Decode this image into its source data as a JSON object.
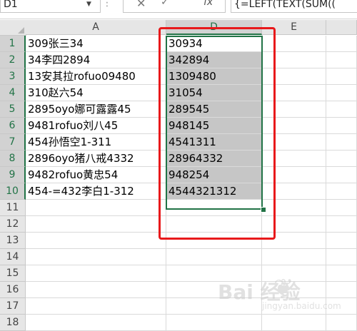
{
  "formula_bar": {
    "name_box": "D1",
    "formula": "{=LEFT(TEXT(SUM(("
  },
  "columns": [
    {
      "label": "A",
      "selected": false
    },
    {
      "label": "D",
      "selected": true
    },
    {
      "label": "E",
      "selected": false
    }
  ],
  "rows": [
    {
      "num": "1",
      "a": "309张三34",
      "d": "30934"
    },
    {
      "num": "2",
      "a": "34李四2894",
      "d": "342894"
    },
    {
      "num": "3",
      "a": "13安其拉rofuo09480",
      "d": "1309480"
    },
    {
      "num": "4",
      "a": "310赵六54",
      "d": "31054"
    },
    {
      "num": "5",
      "a": "2895oyo娜可露露45",
      "d": "289545"
    },
    {
      "num": "6",
      "a": "9481rofuo刘八45",
      "d": "948145"
    },
    {
      "num": "7",
      "a": "454孙悟空1-311",
      "d": "4541311"
    },
    {
      "num": "8",
      "a": "2896oyo猪八戒4332",
      "d": "28964332"
    },
    {
      "num": "9",
      "a": "9482rofuo黄忠54",
      "d": "948254"
    },
    {
      "num": "10",
      "a": "454-=432李白1-312",
      "d": "4544321312"
    },
    {
      "num": "11",
      "a": "",
      "d": ""
    },
    {
      "num": "12",
      "a": "",
      "d": ""
    },
    {
      "num": "13",
      "a": "",
      "d": ""
    },
    {
      "num": "14",
      "a": "",
      "d": ""
    },
    {
      "num": "15",
      "a": "",
      "d": ""
    },
    {
      "num": "16",
      "a": "",
      "d": ""
    },
    {
      "num": "17",
      "a": "",
      "d": ""
    },
    {
      "num": "18",
      "a": "",
      "d": ""
    }
  ],
  "watermark": {
    "brand": "Bai  经验",
    "url": "jingyan.baidu.com"
  },
  "colors": {
    "selection": "#217346",
    "highlight_box": "#e8191b",
    "selected_fill": "#c6c6c6"
  }
}
